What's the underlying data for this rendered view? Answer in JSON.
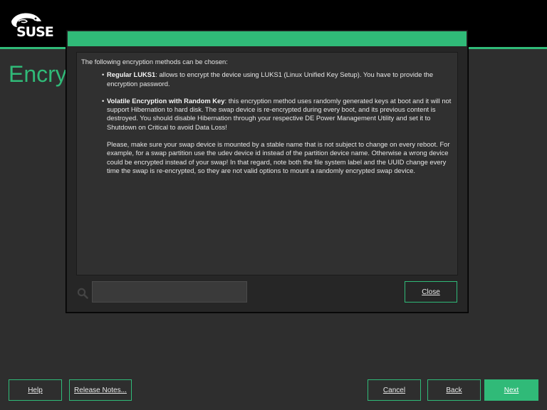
{
  "brand": {
    "logo_text": "SUSE"
  },
  "page": {
    "title": "Encry"
  },
  "dialog": {
    "intro": "The following encryption methods can be chosen:",
    "items": [
      {
        "term": "Regular LUKS1",
        "text": ": allows to encrypt the device using LUKS1 (Linux Unified Key Setup). You have to provide the encryption password."
      },
      {
        "term": "Volatile Encryption with Random Key",
        "text": ": this encryption method uses randomly generated keys at boot and it will not support Hibernation to hard disk. The swap device is re-encrypted during every boot, and its previous content is destroyed. You should disable Hibernation through your respective DE Power Management Utility and set it to Shutdown on Critical to avoid Data Loss!"
      }
    ],
    "note": "Please, make sure your swap device is mounted by a stable name that is not subject to change on every reboot. For example, for a swap partition use the udev device id instead of the partition device name. Otherwise a wrong device could be encrypted instead of your swap! In that regard, note both the file system label and the UUID change every time the swap is re-encrypted, so they are not valid options to mount a randomly encrypted swap device.",
    "search_value": "",
    "close_label": "Close"
  },
  "footer": {
    "help_label": "Help",
    "release_notes_label": "Release Notes...",
    "cancel_label": "Cancel",
    "back_label": "Back",
    "next_label": "Next"
  },
  "colors": {
    "accent": "#30ba78",
    "background": "#2e2e2e",
    "topbar": "#000000"
  }
}
